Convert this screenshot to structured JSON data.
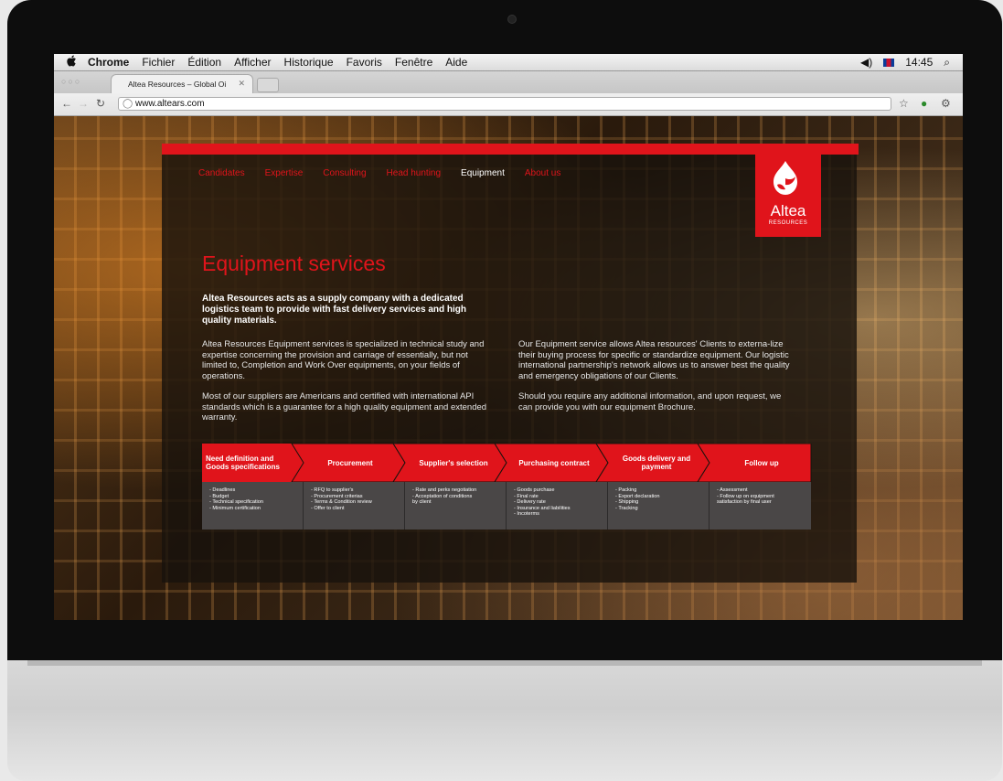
{
  "menubar": {
    "apple": "",
    "items": [
      "Chrome",
      "Fichier",
      "Édition",
      "Afficher",
      "Historique",
      "Favoris",
      "Fenêtre",
      "Aide"
    ],
    "clock": "14:45"
  },
  "browser": {
    "tab_title": "Altea Resources – Global Oi",
    "url": "www.altears.com"
  },
  "site": {
    "logo_name": "Altea",
    "logo_sub": "RESOURCES",
    "nav": [
      "Candidates",
      "Expertise",
      "Consulting",
      "Head hunting",
      "Equipment",
      "About us"
    ],
    "active_nav": "Equipment",
    "heading": "Equipment services",
    "lead": "Altea Resources acts as a supply company with a dedicated logistics team to provide with fast delivery services and high quality materials.",
    "col1": [
      "Altea Resources Equipment services is specialized in technical study and expertise concerning the provision and carriage of essentially, but not limited to, Completion and Work Over equipments, on your fields of operations.",
      "Most of our suppliers are Americans and certified with international API standards which is a guarantee for a high quality equipment and extended warranty."
    ],
    "col2": [
      "Our Equipment service allows Altea resources' Clients to externa-lize their buying process for specific or standardize equipment. Our logistic international partnership's network allows us to answer best the quality and emergency obligations of our Clients.",
      "Should you require any additional information, and upon request, we can provide you with our equipment Brochure."
    ],
    "steps": [
      {
        "label": "Need definition and Goods specifications",
        "details": [
          "- Deadlines",
          "- Budget",
          "- Technical specification",
          "- Minimum certification"
        ]
      },
      {
        "label": "Procurement",
        "details": [
          "- RFQ to supplier's",
          "- Procurement criterias",
          "- Terms & Condition review",
          "- Offer to client"
        ]
      },
      {
        "label": "Supplier's selection",
        "details": [
          "- Rate and perks negotiation",
          "- Acceptation of conditions",
          "by client"
        ]
      },
      {
        "label": "Purchasing contract",
        "details": [
          "- Goods purchase",
          "- Final rate",
          "- Delivery rate",
          "- Insurance and liabilities",
          "- Incoterms"
        ]
      },
      {
        "label": "Goods delivery and payment",
        "details": [
          "- Packing",
          "- Export declaration",
          "- Shipping",
          "- Tracking"
        ]
      },
      {
        "label": "Follow up",
        "details": [
          "- Assessment",
          "- Follow up on equipment",
          "satisfaction by final user"
        ]
      }
    ]
  },
  "colors": {
    "brand_red": "#e0141b",
    "detail_bg": "#4a4747"
  }
}
